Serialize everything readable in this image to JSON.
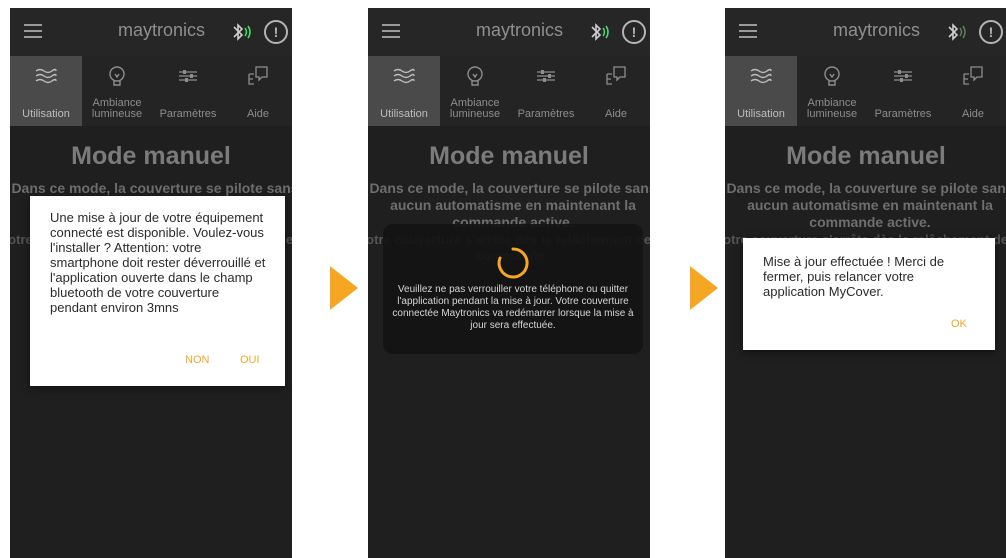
{
  "app": {
    "brand": "maytronics",
    "menu_icon": "hamburger-menu-icon",
    "bluetooth_icon": "bluetooth-icon",
    "alert_icon": "alert-circle-icon",
    "alert_symbol": "!"
  },
  "tabs": [
    {
      "label": "Utilisation",
      "icon": "waves-icon",
      "active": true
    },
    {
      "label": "Ambiance\nlumineuse",
      "icon": "lightbulb-icon",
      "active": false
    },
    {
      "label": "Paramètres",
      "icon": "sliders-icon",
      "active": false
    },
    {
      "label": "Aide",
      "icon": "help-chat-icon",
      "active": false
    }
  ],
  "content": {
    "title": "Mode manuel",
    "description": "Dans ce mode, la couverture se pilote sans aucun automatisme en maintenant la commande active.",
    "description2": "Votre couverture s'arrête dès le relâchement de la commande."
  },
  "screen1": {
    "dialog_message": "Une mise à jour de votre équipement connecté est disponible. Voulez-vous l'installer ? Attention: votre smartphone doit rester déverrouillé et l'application ouverte dans le champ bluetooth de votre couverture pendant environ 3mns",
    "btn_no": "NON",
    "btn_yes": "OUI"
  },
  "screen2": {
    "loading_message": "Veuillez ne pas verrouiller votre téléphone ou quitter l'application pendant la mise à jour. Votre couverture connectée Maytronics va redémarrer lorsque la mise à jour sera effectuée."
  },
  "screen3": {
    "dialog_message": "Mise à jour effectuée ! Merci de fermer, puis relancer votre application MyCover.",
    "btn_ok": "OK"
  },
  "colors": {
    "accent": "#f5a623",
    "bluetooth_signal": "#4cd964"
  }
}
